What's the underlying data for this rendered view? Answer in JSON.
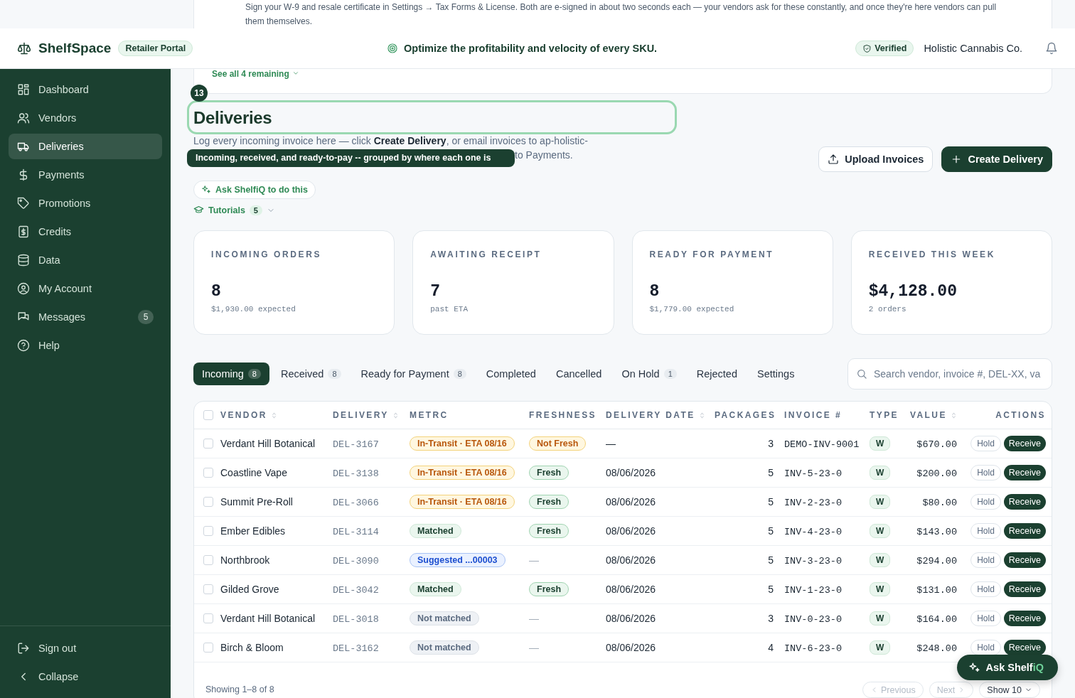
{
  "notice": {
    "text": "Sign your W-9 and resale certificate in Settings → Tax Forms & License. Both are e-signed in about two seconds each — your vendors ask for these constantly, and once they're here vendors can pull them themselves.",
    "link": "See all 4 remaining"
  },
  "header": {
    "brand": "ShelfSpace",
    "portal": "Retailer Portal",
    "tagline": "Optimize the profitability and velocity of every SKU.",
    "verified": "Verified",
    "company": "Holistic Cannabis Co."
  },
  "sidebar": {
    "items": [
      {
        "label": "Dashboard",
        "selected": false
      },
      {
        "label": "Vendors",
        "selected": false
      },
      {
        "label": "Deliveries",
        "selected": true
      },
      {
        "label": "Payments",
        "selected": false
      },
      {
        "label": "Promotions",
        "selected": false
      },
      {
        "label": "Credits",
        "selected": false
      },
      {
        "label": "Data",
        "selected": false
      },
      {
        "label": "My Account",
        "selected": false
      },
      {
        "label": "Messages",
        "selected": false,
        "badge": "5"
      },
      {
        "label": "Help",
        "selected": false
      }
    ],
    "footer": [
      "Sign out",
      "Collapse"
    ]
  },
  "page": {
    "step": "13",
    "title": "Deliveries",
    "description": "Log every incoming invoice here — click **Create Delivery**, or email invoices to ap-holistic-",
    "description_tail": "to Payments.",
    "tooltip": "Incoming, received, and ready-to-pay -- grouped by where each one is",
    "ask": "Ask ShelfiQ to do this",
    "tutorials": {
      "label": "Tutorials",
      "count": "5"
    },
    "actions": [
      {
        "label": "Upload Invoices",
        "kind": "secondary"
      },
      {
        "label": "Create Delivery",
        "kind": "primary"
      }
    ]
  },
  "stats": [
    {
      "label": "INCOMING ORDERS",
      "value": "8",
      "note": "$1,930.00 expected"
    },
    {
      "label": "AWAITING RECEIPT",
      "value": "7",
      "note": "past ETA"
    },
    {
      "label": "READY FOR PAYMENT",
      "value": "8",
      "note": "$1,779.00 expected"
    },
    {
      "label": "RECEIVED THIS WEEK",
      "value": "$4,128.00",
      "note": "2 orders"
    }
  ],
  "tabs": [
    {
      "label": "Incoming",
      "count": "8",
      "selected": true
    },
    {
      "label": "Received",
      "count": "8",
      "selected": false
    },
    {
      "label": "Ready for Payment",
      "count": "8",
      "selected": false
    },
    {
      "label": "Completed",
      "selected": false
    },
    {
      "label": "Cancelled",
      "selected": false
    },
    {
      "label": "On Hold",
      "count": "1",
      "selected": false
    },
    {
      "label": "Rejected",
      "selected": false
    },
    {
      "label": "Settings",
      "selected": false
    }
  ],
  "search": {
    "placeholder": "Search vendor, invoice #, DEL-XX, va"
  },
  "table": {
    "all_checked": false,
    "columns": [
      {
        "label": "VENDOR",
        "sortable": true
      },
      {
        "label": "DELIVERY",
        "sortable": true
      },
      {
        "label": "METRC",
        "sortable": false
      },
      {
        "label": "FRESHNESS",
        "sortable": false
      },
      {
        "label": "DELIVERY DATE",
        "sortable": true
      },
      {
        "label": "PACKAGES",
        "sortable": false
      },
      {
        "label": "INVOICE #",
        "sortable": false
      },
      {
        "label": "TYPE",
        "sortable": false
      },
      {
        "label": "VALUE",
        "sortable": true
      },
      {
        "label": "ACTIONS",
        "sortable": false
      }
    ],
    "rows": [
      {
        "checked": false,
        "vendor": "Verdant Hill Botanical",
        "delivery": "DEL-3167",
        "metrc": {
          "label": "In-Transit · ETA 08/16",
          "kind": "in_transit"
        },
        "freshness": {
          "label": "Not Fresh",
          "kind": "not_fresh"
        },
        "date": "—",
        "packages": "3",
        "invoice": "DEMO-INV-9001",
        "type": "W",
        "value": "$670.00",
        "hold": "Hold",
        "receive": "Receive"
      },
      {
        "checked": false,
        "vendor": "Coastline Vape",
        "delivery": "DEL-3138",
        "metrc": {
          "label": "In-Transit · ETA 08/16",
          "kind": "in_transit"
        },
        "freshness": {
          "label": "Fresh",
          "kind": "fresh"
        },
        "date": "08/06/2026",
        "packages": "5",
        "invoice": "INV-5-23-0",
        "type": "W",
        "value": "$200.00",
        "hold": "Hold",
        "receive": "Receive"
      },
      {
        "checked": false,
        "vendor": "Summit Pre-Roll",
        "delivery": "DEL-3066",
        "metrc": {
          "label": "In-Transit · ETA 08/16",
          "kind": "in_transit"
        },
        "freshness": {
          "label": "Fresh",
          "kind": "fresh"
        },
        "date": "08/06/2026",
        "packages": "5",
        "invoice": "INV-2-23-0",
        "type": "W",
        "value": "$80.00",
        "hold": "Hold",
        "receive": "Receive"
      },
      {
        "checked": false,
        "vendor": "Ember Edibles",
        "delivery": "DEL-3114",
        "metrc": {
          "label": "Matched",
          "kind": "matched"
        },
        "freshness": {
          "label": "Fresh",
          "kind": "fresh"
        },
        "date": "08/06/2026",
        "packages": "5",
        "invoice": "INV-4-23-0",
        "type": "W",
        "value": "$143.00",
        "hold": "Hold",
        "receive": "Receive"
      },
      {
        "checked": false,
        "vendor": "Northbrook",
        "delivery": "DEL-3090",
        "metrc": {
          "label": "Suggested ...00003",
          "kind": "suggested"
        },
        "freshness": {
          "label": "—",
          "kind": "none"
        },
        "date": "08/06/2026",
        "packages": "5",
        "invoice": "INV-3-23-0",
        "type": "W",
        "value": "$294.00",
        "hold": "Hold",
        "receive": "Receive"
      },
      {
        "checked": false,
        "vendor": "Gilded Grove",
        "delivery": "DEL-3042",
        "metrc": {
          "label": "Matched",
          "kind": "matched"
        },
        "freshness": {
          "label": "Fresh",
          "kind": "fresh"
        },
        "date": "08/06/2026",
        "packages": "5",
        "invoice": "INV-1-23-0",
        "type": "W",
        "value": "$131.00",
        "hold": "Hold",
        "receive": "Receive"
      },
      {
        "checked": false,
        "vendor": "Verdant Hill Botanical",
        "delivery": "DEL-3018",
        "metrc": {
          "label": "Not matched",
          "kind": "not_matched"
        },
        "freshness": {
          "label": "—",
          "kind": "none"
        },
        "date": "08/06/2026",
        "packages": "3",
        "invoice": "INV-0-23-0",
        "type": "W",
        "value": "$164.00",
        "hold": "Hold",
        "receive": "Receive"
      },
      {
        "checked": false,
        "vendor": "Birch & Bloom",
        "delivery": "DEL-3162",
        "metrc": {
          "label": "Not matched",
          "kind": "not_matched"
        },
        "freshness": {
          "label": "—",
          "kind": "none"
        },
        "date": "08/06/2026",
        "packages": "4",
        "invoice": "INV-6-23-0",
        "type": "W",
        "value": "$248.00",
        "hold": "Hold",
        "receive": "Receive"
      }
    ],
    "summary": "Showing 1–8 of 8",
    "pager": [
      {
        "label": "Previous",
        "disabled": true
      },
      {
        "label": "Next",
        "disabled": true
      }
    ],
    "page_size": "Show 10"
  },
  "assistant": {
    "label": "Ask Shelf",
    "accent": "iQ"
  }
}
